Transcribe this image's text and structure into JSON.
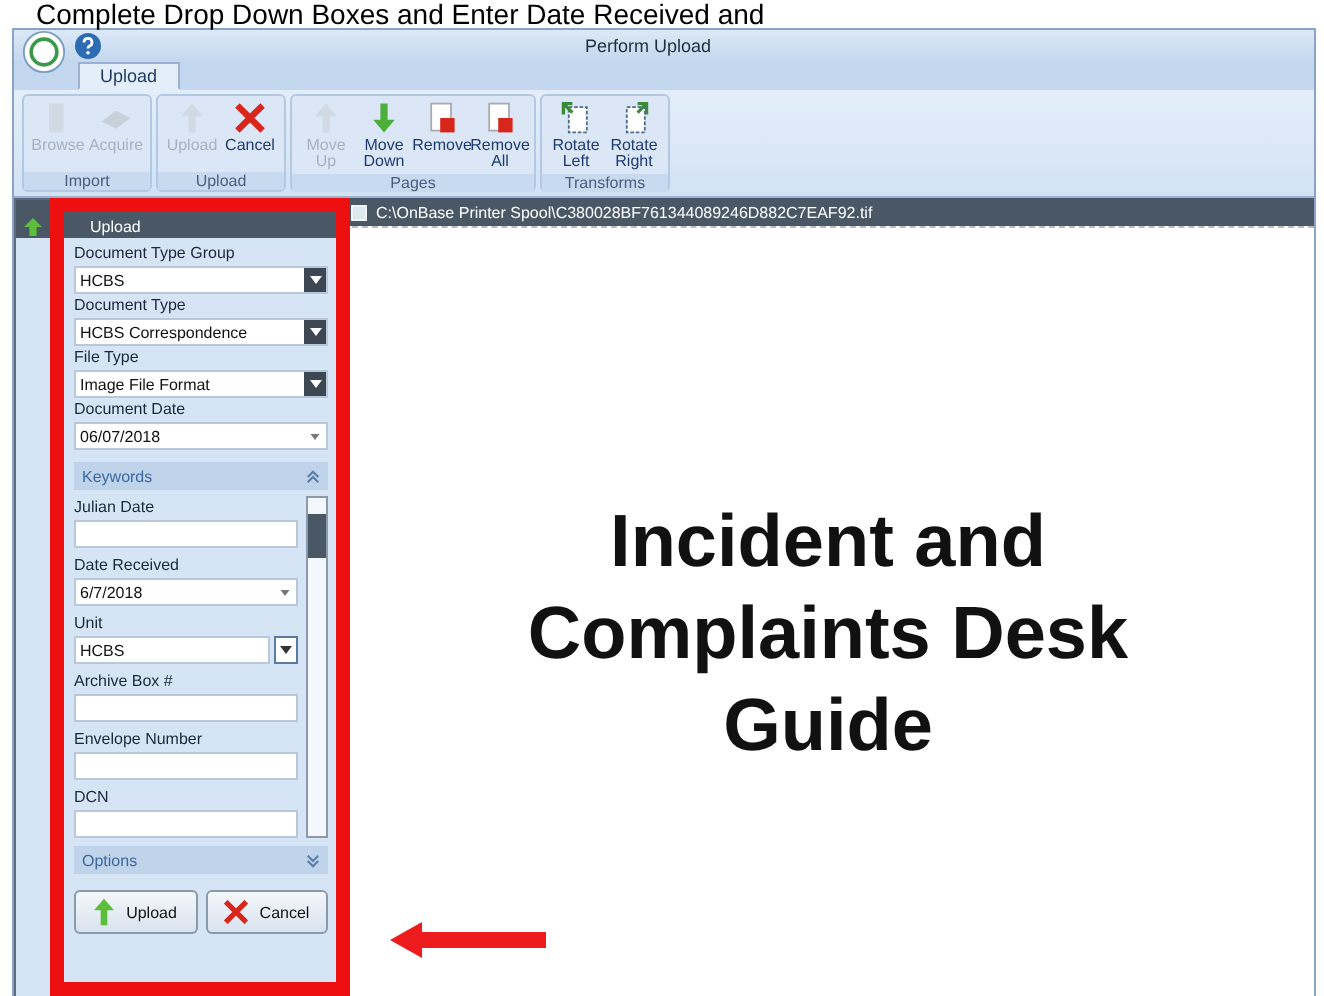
{
  "caption": "Complete Drop Down Boxes and Enter Date Received and",
  "window": {
    "title": "Perform Upload"
  },
  "tabs": [
    {
      "label": "Upload",
      "selected": true
    }
  ],
  "ribbon": [
    {
      "label": "Import",
      "buttons": [
        {
          "label": "Browse",
          "disabled": true
        },
        {
          "label": "Acquire",
          "disabled": true
        }
      ]
    },
    {
      "label": "Upload",
      "buttons": [
        {
          "label": "Upload",
          "disabled": true
        },
        {
          "label": "Cancel",
          "disabled": false
        }
      ]
    },
    {
      "label": "Pages",
      "buttons": [
        {
          "label": "Move Up",
          "disabled": true
        },
        {
          "label": "Move Down",
          "disabled": false
        },
        {
          "label": "Remove",
          "disabled": false
        },
        {
          "label": "Remove All",
          "disabled": false
        }
      ]
    },
    {
      "label": "Transforms",
      "buttons": [
        {
          "label": "Rotate Left",
          "disabled": false
        },
        {
          "label": "Rotate Right",
          "disabled": false
        }
      ]
    }
  ],
  "panel": {
    "title": "Upload",
    "fields": [
      {
        "label": "Document Type Group",
        "value": "HCBS",
        "kind": "select"
      },
      {
        "label": "Document Type",
        "value": "HCBS Correspondence",
        "kind": "select"
      },
      {
        "label": "File Type",
        "value": "Image File Format",
        "kind": "select"
      },
      {
        "label": "Document Date",
        "value": "06/07/2018",
        "kind": "date"
      }
    ],
    "keywords": {
      "title": "Keywords",
      "expanded": true,
      "fields": [
        {
          "label": "Julian Date",
          "kind": "text"
        },
        {
          "label": "Date Received",
          "value": "6/7/2018",
          "kind": "date"
        },
        {
          "label": "Unit",
          "value": "HCBS",
          "kind": "select"
        },
        {
          "label": "Archive Box #",
          "kind": "text"
        },
        {
          "label": "Envelope Number",
          "kind": "text"
        },
        {
          "label": "DCN",
          "kind": "text"
        }
      ]
    },
    "options": {
      "title": "Options",
      "expanded": false
    },
    "buttons": [
      "Upload",
      "Cancel"
    ]
  },
  "document": {
    "path": "C:\\OnBase Printer Spool\\C380028BF761344089246D882C7EAF92.tif",
    "heading": "Incident and Complaints Desk Guide"
  }
}
